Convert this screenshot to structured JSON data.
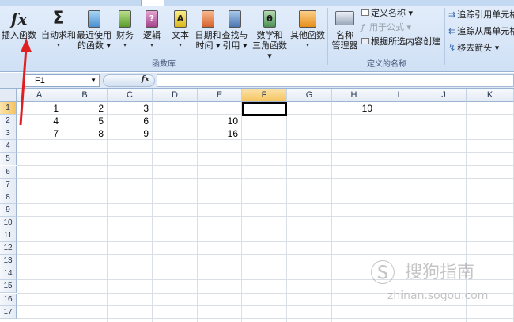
{
  "ribbon": {
    "insert_function_label": "插入函数",
    "buttons": [
      {
        "label1": "自动求和",
        "label2": "▾"
      },
      {
        "label1": "最近使用",
        "label2": "的函数 ▾"
      },
      {
        "label1": "财务",
        "label2": "▾"
      },
      {
        "label1": "逻辑",
        "label2": "▾"
      },
      {
        "label1": "文本",
        "label2": "▾"
      },
      {
        "label1": "日期和",
        "label2": "时间 ▾"
      },
      {
        "label1": "查找与",
        "label2": "引用 ▾"
      },
      {
        "label1": "数学和",
        "label2": "三角函数 ▾"
      },
      {
        "label1": "其他函数",
        "label2": "▾"
      }
    ],
    "group_function_library": "函数库",
    "name_manager_label1": "名称",
    "name_manager_label2": "管理器",
    "define_name": "定义名称 ▾",
    "use_in_formula": "用于公式 ▾",
    "create_from_selection": "根据所选内容创建",
    "group_defined_names": "定义的名称",
    "trace_precedents": "追踪引用单元格",
    "trace_dependents": "追踪从属单元格",
    "remove_arrows": "移去箭头 ▾"
  },
  "formula_bar": {
    "name_box": "F1",
    "fx_label": "fx",
    "formula": ""
  },
  "grid": {
    "columns": [
      "A",
      "B",
      "C",
      "D",
      "E",
      "F",
      "G",
      "H",
      "I",
      "J",
      "K"
    ],
    "selected_column": "F",
    "rows": [
      "1",
      "2",
      "3",
      "4",
      "5",
      "6",
      "7",
      "8",
      "9",
      "10",
      "11",
      "12",
      "13",
      "14",
      "15",
      "16",
      "17"
    ],
    "selected_row": "1",
    "cells": [
      {
        "ref": "A1",
        "value": "1"
      },
      {
        "ref": "B1",
        "value": "2"
      },
      {
        "ref": "C1",
        "value": "3"
      },
      {
        "ref": "H1",
        "value": "10"
      },
      {
        "ref": "A2",
        "value": "4"
      },
      {
        "ref": "B2",
        "value": "5"
      },
      {
        "ref": "C2",
        "value": "6"
      },
      {
        "ref": "E2",
        "value": "10"
      },
      {
        "ref": "A3",
        "value": "7"
      },
      {
        "ref": "B3",
        "value": "8"
      },
      {
        "ref": "C3",
        "value": "9"
      },
      {
        "ref": "E3",
        "value": "16"
      }
    ],
    "active_cell": "F1"
  },
  "watermark": {
    "text": "搜狗指南",
    "url": "zhinan.sogou.com"
  },
  "colors": {
    "annotation_arrow": "#e02020",
    "selection_header": "#f6c45f"
  }
}
